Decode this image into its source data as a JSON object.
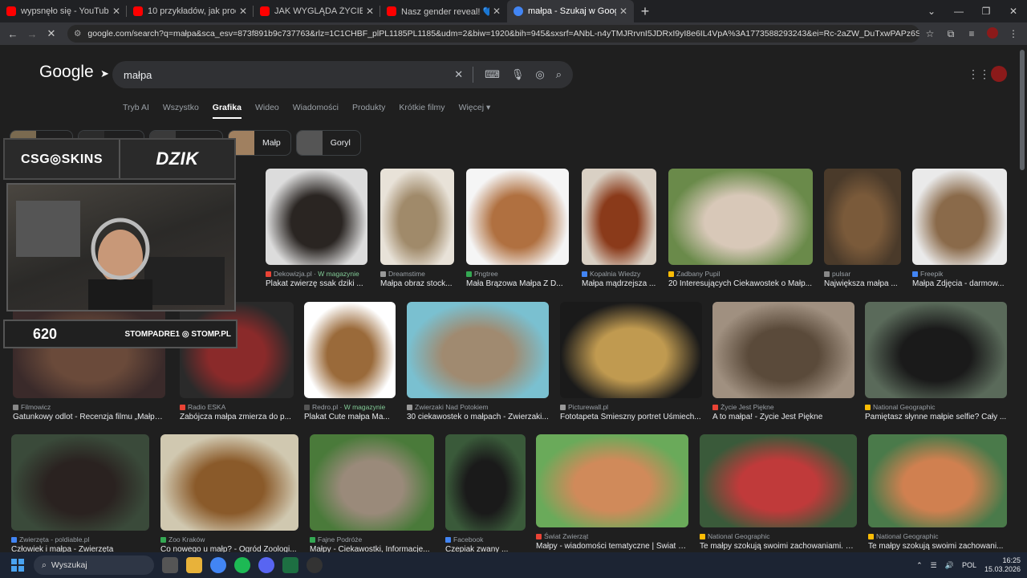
{
  "browser": {
    "tabs": [
      {
        "title": "wypsnęło się - YouTube",
        "color": "#ff0000"
      },
      {
        "title": "10 przykładów, jak producenci",
        "color": "#ff0000"
      },
      {
        "title": "JAK WYGLĄDA ŻYCIE PLEMION",
        "color": "#ff0000"
      },
      {
        "title": "Nasz gender reveal! 💙💗 - Yo",
        "color": "#ff0000"
      },
      {
        "title": "małpa - Szukaj w Google",
        "color": "#4285f4"
      }
    ],
    "url": "google.com/search?q=małpa&sca_esv=873f891b9c737763&rlz=1C1CHBF_plPL1185PL1185&udm=2&biw=1920&bih=945&sxsrf=ANbL-n4yTMJRrvnI5JDRxI9yI8e6IL4VpA%3A1773588293243&ei=Rc-2aZW_DuTxwPAPz6Si2A0&ved=0ahUKEwjV9cihm..."
  },
  "google": {
    "logo": "Google",
    "query": "małpa",
    "nav": [
      "Tryb AI",
      "Wszystko",
      "Grafika",
      "Wideo",
      "Wiadomości",
      "Produkty",
      "Krótkie filmy",
      "Więcej"
    ],
    "active_nav": "Grafika",
    "chips": [
      {
        "label": "",
        "thumb": "#7a6a50"
      },
      {
        "label": "",
        "thumb": "#2b2b2b"
      },
      {
        "label": "",
        "thumb": "#3a3a3a"
      },
      {
        "label": "Małp",
        "thumb": "#a08060"
      },
      {
        "label": "Goryl",
        "thumb": "#555"
      }
    ]
  },
  "results": [
    {
      "source": "Dekowizja.pl",
      "magazine": "W magazynie",
      "caption": "Plakat zwierzę ssak dziki ...",
      "c1": "#dcdcdc",
      "c2": "#2a2522",
      "icon": "#ea4335"
    },
    {
      "source": "Dreamstime",
      "magazine": "",
      "caption": "Małpa obraz stock...",
      "c1": "#e8e2d8",
      "c2": "#a08a6a",
      "icon": "#999"
    },
    {
      "source": "Pngtree",
      "magazine": "",
      "caption": "Mała Brązowa Małpa Z D...",
      "c1": "#f5f5f5",
      "c2": "#b07040",
      "icon": "#34a853"
    },
    {
      "source": "Kopalnia Wiedzy",
      "magazine": "",
      "caption": "Małpa mądrzejsza ...",
      "c1": "#d9d0c4",
      "c2": "#8a3a1a",
      "icon": "#4285f4"
    },
    {
      "source": "Zadbany Pupil",
      "magazine": "",
      "caption": "20 Interesujących Ciekawostek o Małp...",
      "c1": "#6a8a4a",
      "c2": "#d8c8b8",
      "icon": "#fbbc05"
    },
    {
      "source": "pulsar",
      "magazine": "",
      "caption": "Największa małpa ...",
      "c1": "#4a3a2a",
      "c2": "#7a5a3a",
      "icon": "#888"
    },
    {
      "source": "Freepik",
      "magazine": "",
      "caption": "Małpa Zdjęcia - darmow...",
      "c1": "#eaeaea",
      "c2": "#8a6a4a",
      "icon": "#4285f4"
    },
    {
      "source": "Filmowicz",
      "magazine": "",
      "caption": "Gatunkowy odlot - Recenzja filmu „Małpa\"...",
      "c1": "#3a2a2a",
      "c2": "#6a4a3a",
      "icon": "#888"
    },
    {
      "source": "Radio ESKA",
      "magazine": "",
      "caption": "Zabójcza małpa zmierza do p...",
      "c1": "#2a2a2a",
      "c2": "#8a2a2a",
      "icon": "#ea4335"
    },
    {
      "source": "Redro.pl",
      "magazine": "W magazynie",
      "caption": "Plakat Cute małpa Ma...",
      "c1": "#ffffff",
      "c2": "#9a6a3a",
      "icon": "#555"
    },
    {
      "source": "Zwierzaki Nad Potokiem",
      "magazine": "",
      "caption": "30 ciekawostek o małpach - Zwierzaki...",
      "c1": "#7ac0d0",
      "c2": "#a08a70",
      "icon": "#999"
    },
    {
      "source": "Picturewall.pl",
      "magazine": "",
      "caption": "Fototapeta Śmieszny portret Uśmiech...",
      "c1": "#1a1a1a",
      "c2": "#c09a50",
      "icon": "#999"
    },
    {
      "source": "Życie Jest Piękne",
      "magazine": "",
      "caption": "A to małpa! - Życie Jest Piękne",
      "c1": "#a09080",
      "c2": "#5a4a3a",
      "icon": "#ea4335"
    },
    {
      "source": "National Geographic",
      "magazine": "",
      "caption": "Pamiętasz słynne małpie selfie? Cały ...",
      "c1": "#5a6a5a",
      "c2": "#1a1a1a",
      "icon": "#fbbc05"
    },
    {
      "source": "Zwierzęta - poldiable.pl",
      "magazine": "",
      "caption": "Człowiek i małpa - Zwierzęta",
      "c1": "#3a4a3a",
      "c2": "#2a2220",
      "icon": "#4285f4"
    },
    {
      "source": "Zoo Kraków",
      "magazine": "",
      "caption": "Co nowego u małp? - Ogród Zoologi...",
      "c1": "#d0c8b0",
      "c2": "#8a5a2a",
      "icon": "#34a853"
    },
    {
      "source": "Fajne Podróże",
      "magazine": "",
      "caption": "Małpy - Ciekawostki, Informacje...",
      "c1": "#4a7a3a",
      "c2": "#9a8a7a",
      "icon": "#34a853"
    },
    {
      "source": "Facebook",
      "magazine": "",
      "caption": "Czepiak zwany ...",
      "c1": "#3a5a3a",
      "c2": "#1a1a1a",
      "icon": "#4285f4"
    },
    {
      "source": "Świat Zwierząt",
      "magazine": "",
      "caption": "Małpy - wiadomości tematyczne | Świat Z...",
      "c1": "#6aaa5a",
      "c2": "#d08a5a",
      "icon": "#ea4335"
    },
    {
      "source": "National Geographic",
      "magazine": "",
      "caption": "Te małpy szokują swoimi zachowaniami. N...",
      "c1": "#3a5a3a",
      "c2": "#c03a3a",
      "icon": "#fbbc05"
    },
    {
      "source": "National Geographic",
      "magazine": "",
      "caption": "Te małpy szokują swoimi zachowani...",
      "c1": "#4a7a4a",
      "c2": "#d08050",
      "icon": "#fbbc05"
    }
  ],
  "overlay": {
    "sponsor_left": "CSG◎SKINS",
    "sponsor_right": "DZIK",
    "count": "620",
    "handles": "STOMPADRE1  ◎ STOMP.PL"
  },
  "taskbar": {
    "search": "Wyszukaj",
    "lang": "POL",
    "time": "16:25",
    "date": "15.03.2026"
  }
}
